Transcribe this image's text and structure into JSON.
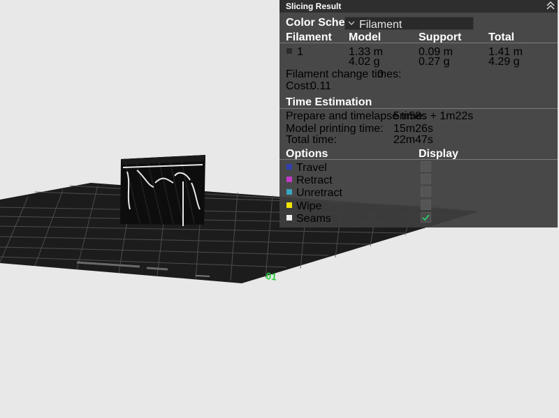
{
  "panel": {
    "title": "Slicing Result",
    "color_scheme_label": "Color Scheme",
    "color_scheme_value": "Filament",
    "table_headers": [
      "Filament",
      "Model",
      "Support",
      "Total"
    ],
    "filament_row": {
      "id": "1",
      "model_length": "1.33 m",
      "model_weight": "4.02 g",
      "support_length": "0.09 m",
      "support_weight": "0.27 g",
      "total_length": "1.41 m",
      "total_weight": "4.29 g",
      "swatch_color": "#2b2b2b"
    },
    "filament_change_label": "Filament change times:",
    "filament_change_value": "0",
    "cost_label": "Cost:",
    "cost_value": "0.11",
    "time_estimation": {
      "title": "Time Estimation",
      "rows": [
        {
          "label": "Prepare and timelapse time:",
          "value": "5m58s + 1m22s"
        },
        {
          "label": "Model printing time:",
          "value": "15m26s"
        },
        {
          "label": "Total time:",
          "value": "22m47s"
        }
      ]
    },
    "options_header": "Options",
    "display_header": "Display",
    "options": [
      {
        "label": "Travel",
        "color": "#2f3fb0",
        "checked": false
      },
      {
        "label": "Retract",
        "color": "#c23ac8",
        "checked": false
      },
      {
        "label": "Unretract",
        "color": "#3aa6c2",
        "checked": false
      },
      {
        "label": "Wipe",
        "color": "#f2e600",
        "checked": false
      },
      {
        "label": "Seams",
        "color": "#eeeeee",
        "checked": true
      }
    ]
  },
  "scene": {
    "bed_color": "#1c1c1c",
    "grid_color": "#5a5a5a",
    "model_color": "#0d0d0d",
    "bed_mark_color": "#2ecc40"
  }
}
